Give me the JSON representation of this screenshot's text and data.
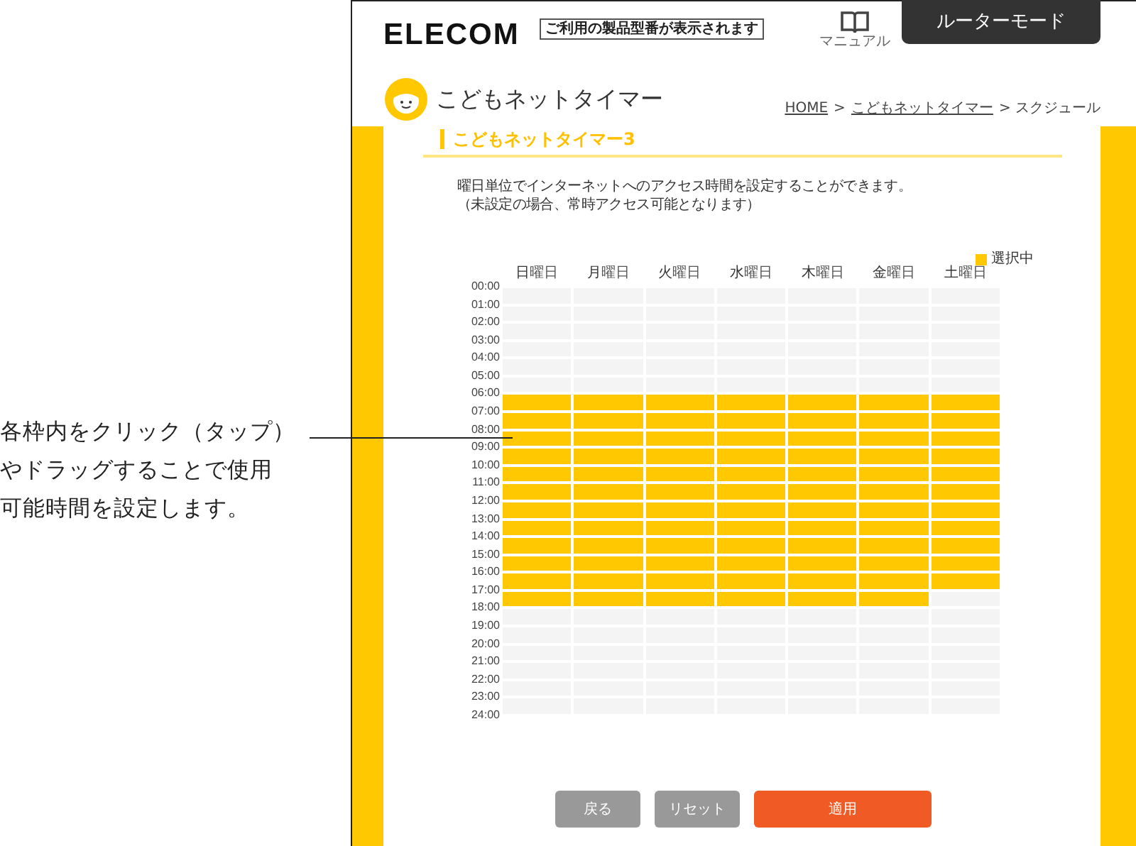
{
  "annotation": {
    "lines": [
      "各枠内をクリック（タップ）",
      "やドラッグすることで使用",
      "可能時間を設定します。"
    ]
  },
  "header": {
    "logo": "ELECOM",
    "model_hint": "ご利用の製品型番が表示されます",
    "manual_label": "マニュアル",
    "mode_tab": "ルーターモード"
  },
  "page_title": "こどもネットタイマー",
  "breadcrumb": [
    {
      "text": "HOME",
      "kind": "link"
    },
    {
      "text": ">",
      "kind": "text"
    },
    {
      "text": "こどもネットタイマー",
      "kind": "link"
    },
    {
      "text": "> スクジュール",
      "kind": "text"
    }
  ],
  "section_title": "こどもネットタイマー3",
  "description": [
    "曜日単位でインターネットへのアクセス時間を設定することができます。",
    "（未設定の場合、常時アクセス可能となります）"
  ],
  "legend": "選択中",
  "days": [
    {
      "name": "日",
      "suffix": "曜日"
    },
    {
      "name": "月",
      "suffix": "曜日"
    },
    {
      "name": "火",
      "suffix": "曜日"
    },
    {
      "name": "水",
      "suffix": "曜日"
    },
    {
      "name": "木",
      "suffix": "曜日"
    },
    {
      "name": "金",
      "suffix": "曜日"
    },
    {
      "name": "土",
      "suffix": "曜日"
    }
  ],
  "time_labels": [
    "00:00",
    "01:00",
    "02:00",
    "03:00",
    "04:00",
    "05:00",
    "06:00",
    "07:00",
    "08:00",
    "09:00",
    "10:00",
    "11:00",
    "12:00",
    "13:00",
    "14:00",
    "15:00",
    "16:00",
    "17:00",
    "18:00",
    "19:00",
    "20:00",
    "21:00",
    "22:00",
    "23:00",
    "24:00"
  ],
  "rows": [
    {
      "selected": [
        false,
        false,
        false,
        false,
        false,
        false,
        false
      ]
    },
    {
      "selected": [
        false,
        false,
        false,
        false,
        false,
        false,
        false
      ]
    },
    {
      "selected": [
        false,
        false,
        false,
        false,
        false,
        false,
        false
      ]
    },
    {
      "selected": [
        false,
        false,
        false,
        false,
        false,
        false,
        false
      ]
    },
    {
      "selected": [
        false,
        false,
        false,
        false,
        false,
        false,
        false
      ]
    },
    {
      "selected": [
        false,
        false,
        false,
        false,
        false,
        false,
        false
      ]
    },
    {
      "selected": [
        true,
        true,
        true,
        true,
        true,
        true,
        true
      ]
    },
    {
      "selected": [
        true,
        true,
        true,
        true,
        true,
        true,
        true
      ]
    },
    {
      "selected": [
        true,
        true,
        true,
        true,
        true,
        true,
        true
      ]
    },
    {
      "selected": [
        true,
        true,
        true,
        true,
        true,
        true,
        true
      ]
    },
    {
      "selected": [
        true,
        true,
        true,
        true,
        true,
        true,
        true
      ]
    },
    {
      "selected": [
        true,
        true,
        true,
        true,
        true,
        true,
        true
      ]
    },
    {
      "selected": [
        true,
        true,
        true,
        true,
        true,
        true,
        true
      ]
    },
    {
      "selected": [
        true,
        true,
        true,
        true,
        true,
        true,
        true
      ]
    },
    {
      "selected": [
        true,
        true,
        true,
        true,
        true,
        true,
        true
      ]
    },
    {
      "selected": [
        true,
        true,
        true,
        true,
        true,
        true,
        true
      ]
    },
    {
      "selected": [
        true,
        true,
        true,
        true,
        true,
        true,
        true
      ]
    },
    {
      "selected": [
        true,
        true,
        true,
        true,
        true,
        true,
        false
      ]
    },
    {
      "selected": [
        false,
        false,
        false,
        false,
        false,
        false,
        false
      ]
    },
    {
      "selected": [
        false,
        false,
        false,
        false,
        false,
        false,
        false
      ]
    },
    {
      "selected": [
        false,
        false,
        false,
        false,
        false,
        false,
        false
      ]
    },
    {
      "selected": [
        false,
        false,
        false,
        false,
        false,
        false,
        false
      ]
    },
    {
      "selected": [
        false,
        false,
        false,
        false,
        false,
        false,
        false
      ]
    },
    {
      "selected": [
        false,
        false,
        false,
        false,
        false,
        false,
        false
      ]
    }
  ],
  "buttons": [
    {
      "label": "戻る",
      "kind": "secondary"
    },
    {
      "label": "リセット",
      "kind": "secondary"
    },
    {
      "label": "適用",
      "kind": "primary"
    }
  ]
}
